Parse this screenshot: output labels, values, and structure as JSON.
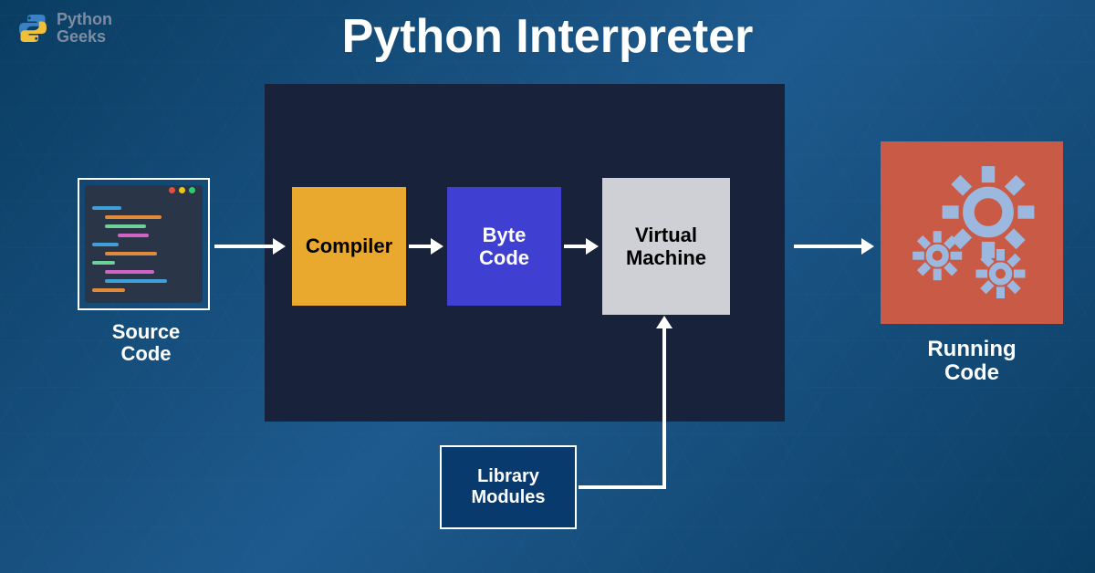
{
  "brand": {
    "line1": "Python",
    "line2": "Geeks"
  },
  "title": "Python Interpreter",
  "nodes": {
    "source": "Source\nCode",
    "compiler": "Compiler",
    "bytecode": "Byte\nCode",
    "vm": "Virtual\nMachine",
    "library": "Library\nModules",
    "running": "Running\nCode"
  },
  "colors": {
    "compiler": "#e9a82e",
    "bytecode": "#3f3fd1",
    "vm": "#cfcfd6",
    "running": "#c95a45",
    "library": "#093a6e",
    "interpreter_panel": "#18223a"
  },
  "flow": [
    [
      "source",
      "compiler"
    ],
    [
      "compiler",
      "bytecode"
    ],
    [
      "bytecode",
      "vm"
    ],
    [
      "vm",
      "running"
    ],
    [
      "library",
      "vm"
    ]
  ]
}
